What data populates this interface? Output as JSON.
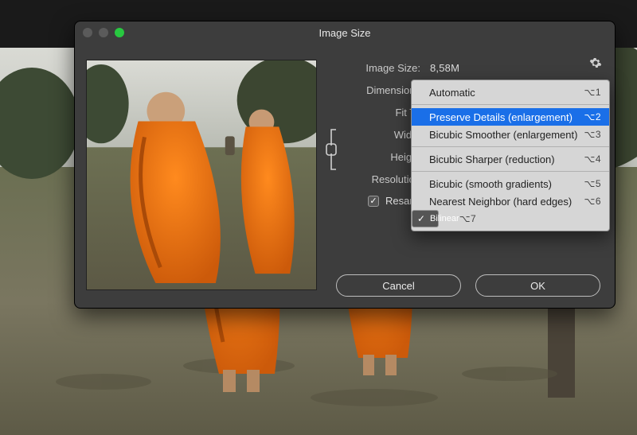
{
  "window": {
    "title": "Image Size"
  },
  "form": {
    "image_size_label": "Image Size:",
    "image_size_value": "8,58M",
    "dimensions_label": "Dimensions",
    "fit_to_label": "Fit To",
    "width_label": "Width",
    "height_label": "Height",
    "resolution_label": "Resolution",
    "resample_label": "Resample"
  },
  "menu": {
    "items": [
      {
        "label": "Automatic",
        "shortcut": "⌥1"
      },
      {
        "label": "Preserve Details (enlargement)",
        "shortcut": "⌥2",
        "selected": true
      },
      {
        "label": "Bicubic Smoother (enlargement)",
        "shortcut": "⌥3"
      },
      {
        "label": "Bicubic Sharper (reduction)",
        "shortcut": "⌥4"
      },
      {
        "label": "Bicubic (smooth gradients)",
        "shortcut": "⌥5"
      },
      {
        "label": "Nearest Neighbor (hard edges)",
        "shortcut": "⌥6"
      },
      {
        "label": "Bilinear",
        "shortcut": "⌥7",
        "checked": true
      }
    ]
  },
  "buttons": {
    "cancel": "Cancel",
    "ok": "OK"
  }
}
